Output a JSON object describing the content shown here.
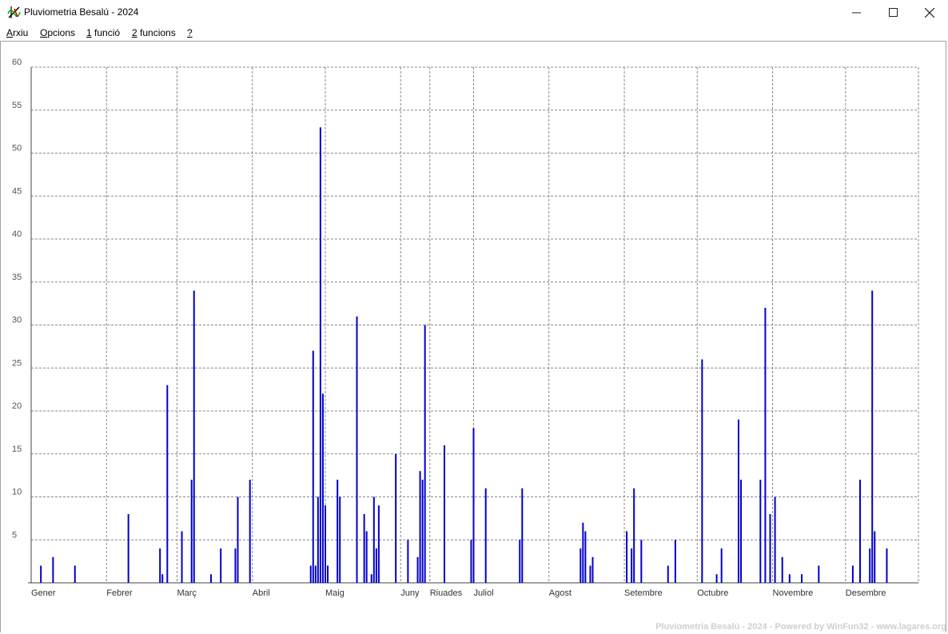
{
  "window": {
    "title": "Pluviometria Besalú - 2024",
    "minimize_icon": "minimize-icon",
    "maximize_icon": "maximize-icon",
    "close_icon": "close-icon"
  },
  "menu": {
    "items": [
      {
        "label": "Arxiu",
        "underline": "A",
        "rest": "rxiu"
      },
      {
        "label": "Opcions",
        "underline": "O",
        "rest": "pcions"
      },
      {
        "label": "1 funció",
        "underline": "1",
        "rest": " funció"
      },
      {
        "label": "2 funcions",
        "underline": "2",
        "rest": " funcions"
      },
      {
        "label": "?",
        "underline": "?",
        "rest": ""
      }
    ]
  },
  "chart_data": {
    "type": "bar",
    "title": "",
    "xlabel": "",
    "ylabel": "",
    "ylim": [
      0,
      60
    ],
    "yticks": [
      5,
      10,
      15,
      20,
      25,
      30,
      35,
      40,
      45,
      50,
      55,
      60
    ],
    "xlim": [
      1,
      366
    ],
    "grid": true,
    "month_labels": [
      {
        "label": "Gener",
        "day": 1
      },
      {
        "label": "Febrer",
        "day": 32
      },
      {
        "label": "Març",
        "day": 61
      },
      {
        "label": "Abril",
        "day": 92
      },
      {
        "label": "Maig",
        "day": 122
      },
      {
        "label": "Juny",
        "day": 153
      },
      {
        "label": "Riuades",
        "day": 165
      },
      {
        "label": "Juliol",
        "day": 183
      },
      {
        "label": "Agost",
        "day": 214
      },
      {
        "label": "Setembre",
        "day": 245
      },
      {
        "label": "Octubre",
        "day": 275
      },
      {
        "label": "Novembre",
        "day": 306
      },
      {
        "label": "Desembre",
        "day": 336
      }
    ],
    "series": [
      {
        "color": "#0000cc",
        "points": [
          [
            5,
            2
          ],
          [
            10,
            3
          ],
          [
            19,
            2
          ],
          [
            41,
            8
          ],
          [
            54,
            4
          ],
          [
            55,
            1
          ],
          [
            57,
            23
          ],
          [
            63,
            6
          ],
          [
            67,
            12
          ],
          [
            68,
            34
          ],
          [
            75,
            1
          ],
          [
            79,
            4
          ],
          [
            85,
            4
          ],
          [
            86,
            10
          ],
          [
            91,
            12
          ],
          [
            116,
            2
          ],
          [
            117,
            27
          ],
          [
            118,
            2
          ],
          [
            119,
            10
          ],
          [
            120,
            53
          ],
          [
            121,
            22
          ],
          [
            122,
            9
          ],
          [
            123,
            2
          ],
          [
            127,
            12
          ],
          [
            128,
            10
          ],
          [
            135,
            31
          ],
          [
            138,
            8
          ],
          [
            139,
            6
          ],
          [
            141,
            1
          ],
          [
            142,
            10
          ],
          [
            143,
            4
          ],
          [
            144,
            9
          ],
          [
            151,
            15
          ],
          [
            156,
            5
          ],
          [
            160,
            3
          ],
          [
            161,
            13
          ],
          [
            162,
            12
          ],
          [
            163,
            30
          ],
          [
            171,
            16
          ],
          [
            182,
            5
          ],
          [
            183,
            18
          ],
          [
            188,
            11
          ],
          [
            202,
            5
          ],
          [
            203,
            11
          ],
          [
            227,
            4
          ],
          [
            228,
            7
          ],
          [
            229,
            6
          ],
          [
            231,
            2
          ],
          [
            232,
            3
          ],
          [
            246,
            6
          ],
          [
            248,
            4
          ],
          [
            249,
            11
          ],
          [
            252,
            5
          ],
          [
            263,
            2
          ],
          [
            266,
            5
          ],
          [
            277,
            26
          ],
          [
            283,
            1
          ],
          [
            285,
            4
          ],
          [
            292,
            19
          ],
          [
            293,
            12
          ],
          [
            301,
            12
          ],
          [
            303,
            32
          ],
          [
            305,
            8
          ],
          [
            307,
            10
          ],
          [
            310,
            3
          ],
          [
            313,
            1
          ],
          [
            318,
            1
          ],
          [
            325,
            2
          ],
          [
            339,
            2
          ],
          [
            342,
            12
          ],
          [
            346,
            4
          ],
          [
            347,
            34
          ],
          [
            348,
            6
          ],
          [
            353,
            4
          ]
        ]
      }
    ]
  },
  "footer": {
    "text": "Pluviometria Besalú - 2024 - Powered by WinFun32 - www.lagares.org"
  }
}
